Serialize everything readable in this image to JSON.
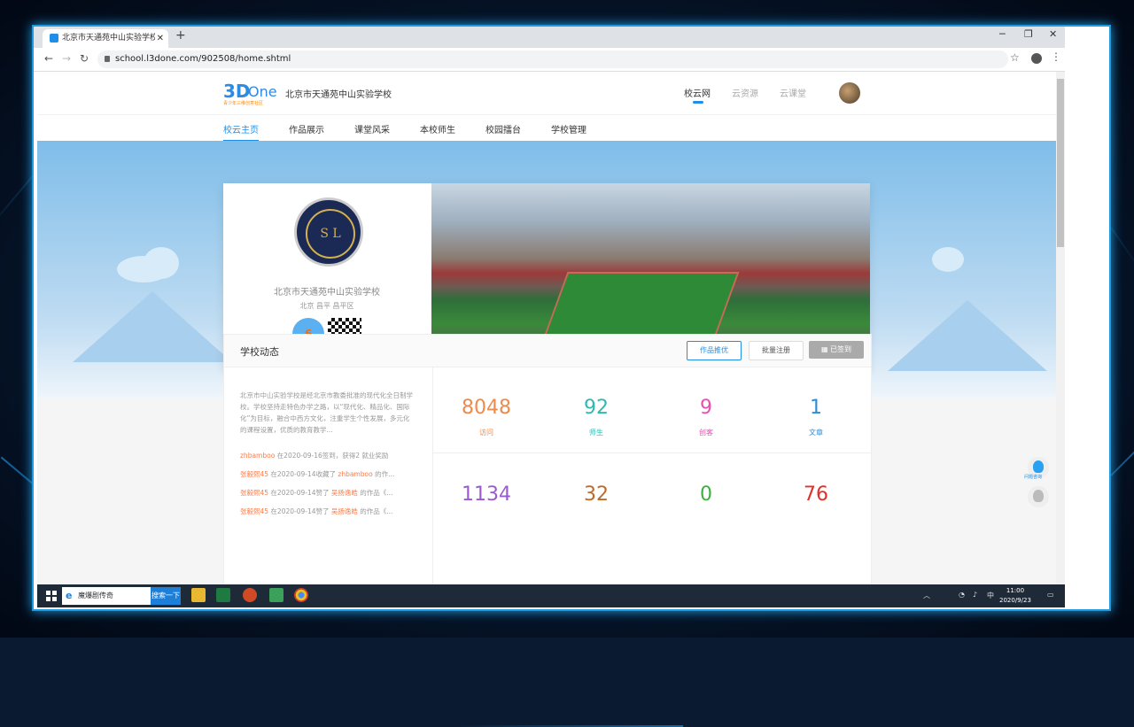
{
  "browser": {
    "tab_title": "北京市天通苑中山实验学校_学校",
    "url": "school.l3done.com/902508/home.shtml"
  },
  "header": {
    "logo_main": "3D",
    "logo_one": "One",
    "logo_sub": "青少年三维创意社区",
    "school_name": "北京市天通苑中山实验学校",
    "nav": [
      {
        "label": "校云网"
      },
      {
        "label": "云资源"
      },
      {
        "label": "云课堂"
      }
    ]
  },
  "subnav": [
    {
      "label": "校云主页"
    },
    {
      "label": "作品展示"
    },
    {
      "label": "课堂风采"
    },
    {
      "label": "本校师生"
    },
    {
      "label": "校园擂台"
    },
    {
      "label": "学校管理"
    }
  ],
  "school_card": {
    "name": "北京市天通苑中山实验学校",
    "location": "北京 昌平 昌平区",
    "badge_text": "S L",
    "medal": "6"
  },
  "dynamics": {
    "title": "学校动态",
    "buttons": {
      "recommend": "作品推优",
      "batch": "批量注册",
      "signed": "已签到"
    },
    "intro": "北京市中山实验学校是经北京市教委批准的现代化全日制学校。学校坚持走特色办学之路，以“现代化、精品化、国际化”为目标，融合中西方文化，注重学生个性发展，多元化的课程设置，优质的教育教学...",
    "feed": [
      {
        "user": "zhbamboo",
        "text": " 在2020-09-16签到，获得2 就业奖励"
      },
      {
        "user": "张毅熙45",
        "text": " 在2020-09-14收藏了 ",
        "target": "zhbamboo",
        "tail": " 的作..."
      },
      {
        "user": "张毅熙45",
        "text": " 在2020-09-14赞了 ",
        "target": "吴扬逸皓",
        "tail": " 的作品《..."
      },
      {
        "user": "张毅熙45",
        "text": " 在2020-09-14赞了 ",
        "target": "吴扬逸皓",
        "tail": " 的作品《..."
      }
    ],
    "stats": [
      {
        "value": "8048",
        "label": "访问",
        "color": "#f08a4b"
      },
      {
        "value": "92",
        "label": "师生",
        "color": "#2bbbb0"
      },
      {
        "value": "9",
        "label": "创客",
        "color": "#e84fb0"
      },
      {
        "value": "1",
        "label": "文章",
        "color": "#2a8fd8"
      },
      {
        "value": "1134",
        "label": "",
        "color": "#9b5bd0"
      },
      {
        "value": "32",
        "label": "",
        "color": "#c06a2a"
      },
      {
        "value": "0",
        "label": "",
        "color": "#3ab040"
      },
      {
        "value": "76",
        "label": "",
        "color": "#e0302a"
      }
    ]
  },
  "float": {
    "qq_label": "问题咨询"
  },
  "taskbar": {
    "search_text": "魔爆剧传奇",
    "search_button": "搜索一下",
    "ime": "中",
    "time": "11:00",
    "date": "2020/9/23"
  }
}
